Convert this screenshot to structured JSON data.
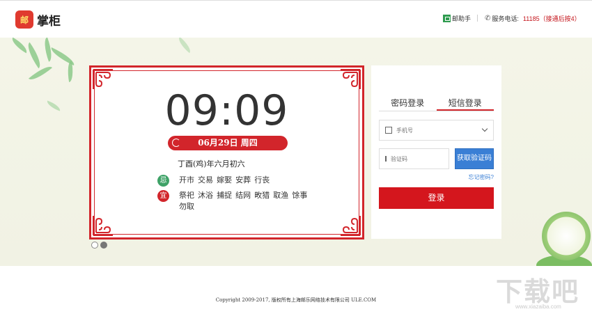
{
  "header": {
    "logo_badge": "邮",
    "logo_text": "掌柜",
    "helper_label": "邮助手",
    "service_label": "服务电话:",
    "service_number": "11185（接通后按4）"
  },
  "calendar": {
    "time": "09:09",
    "date": "06月29日 周四",
    "lunar": "丁酉(鸡)年六月初六",
    "ji_label": "忌",
    "ji_text": "开市 交易 嫁娶 安葬 行丧",
    "yi_label": "宜",
    "yi_text": "祭祀 沐浴 捕捉 结网 畋猎 取渔 馀事勿取"
  },
  "login": {
    "tabs": [
      {
        "label": "密码登录",
        "active": false
      },
      {
        "label": "短信登录",
        "active": true
      }
    ],
    "phone_placeholder": "手机号",
    "code_placeholder": "验证码",
    "get_code_label": "获取验证码",
    "forgot_label": "忘记密码?",
    "submit_label": "登录"
  },
  "footer": {
    "copyright": "Copyright 2009-2017, 版权所有上海邮乐网络技术有限公司 ULE.COM"
  },
  "watermark": {
    "main": "下载吧",
    "sub": "www.xiazaiba.com"
  },
  "colors": {
    "brand_red": "#d2252b",
    "button_blue": "#3a7fd5",
    "banner_bg": "#f4f5e8"
  }
}
